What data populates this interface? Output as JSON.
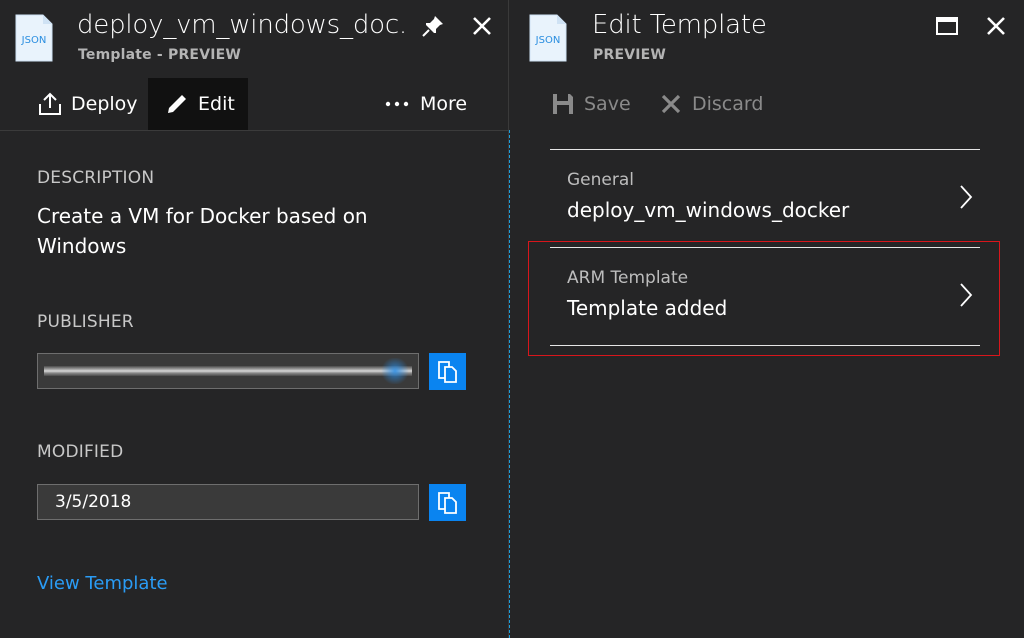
{
  "left_blade": {
    "icon_label": "JSON",
    "icon": "json-file-icon",
    "title": "deploy_vm_windows_doc...",
    "subtitle": "Template - PREVIEW",
    "toolbar": {
      "deploy_label": "Deploy",
      "edit_label": "Edit",
      "more_label": "More"
    },
    "description_label": "DESCRIPTION",
    "description_value": "Create a VM for Docker based on Windows",
    "publisher_label": "PUBLISHER",
    "modified_label": "MODIFIED",
    "modified_value": "3/5/2018",
    "view_template_link": "View Template"
  },
  "right_blade": {
    "icon_label": "JSON",
    "icon": "json-file-icon",
    "title": "Edit Template",
    "subtitle": "PREVIEW",
    "toolbar": {
      "save_label": "Save",
      "discard_label": "Discard"
    },
    "rows": [
      {
        "label": "General",
        "value": "deploy_vm_windows_docker"
      },
      {
        "label": "ARM Template",
        "value": "Template added"
      }
    ]
  },
  "colors": {
    "background": "#252526",
    "accent_blue": "#0a84f0",
    "link_blue": "#2a9cf5",
    "highlight_red": "#d9161c"
  }
}
